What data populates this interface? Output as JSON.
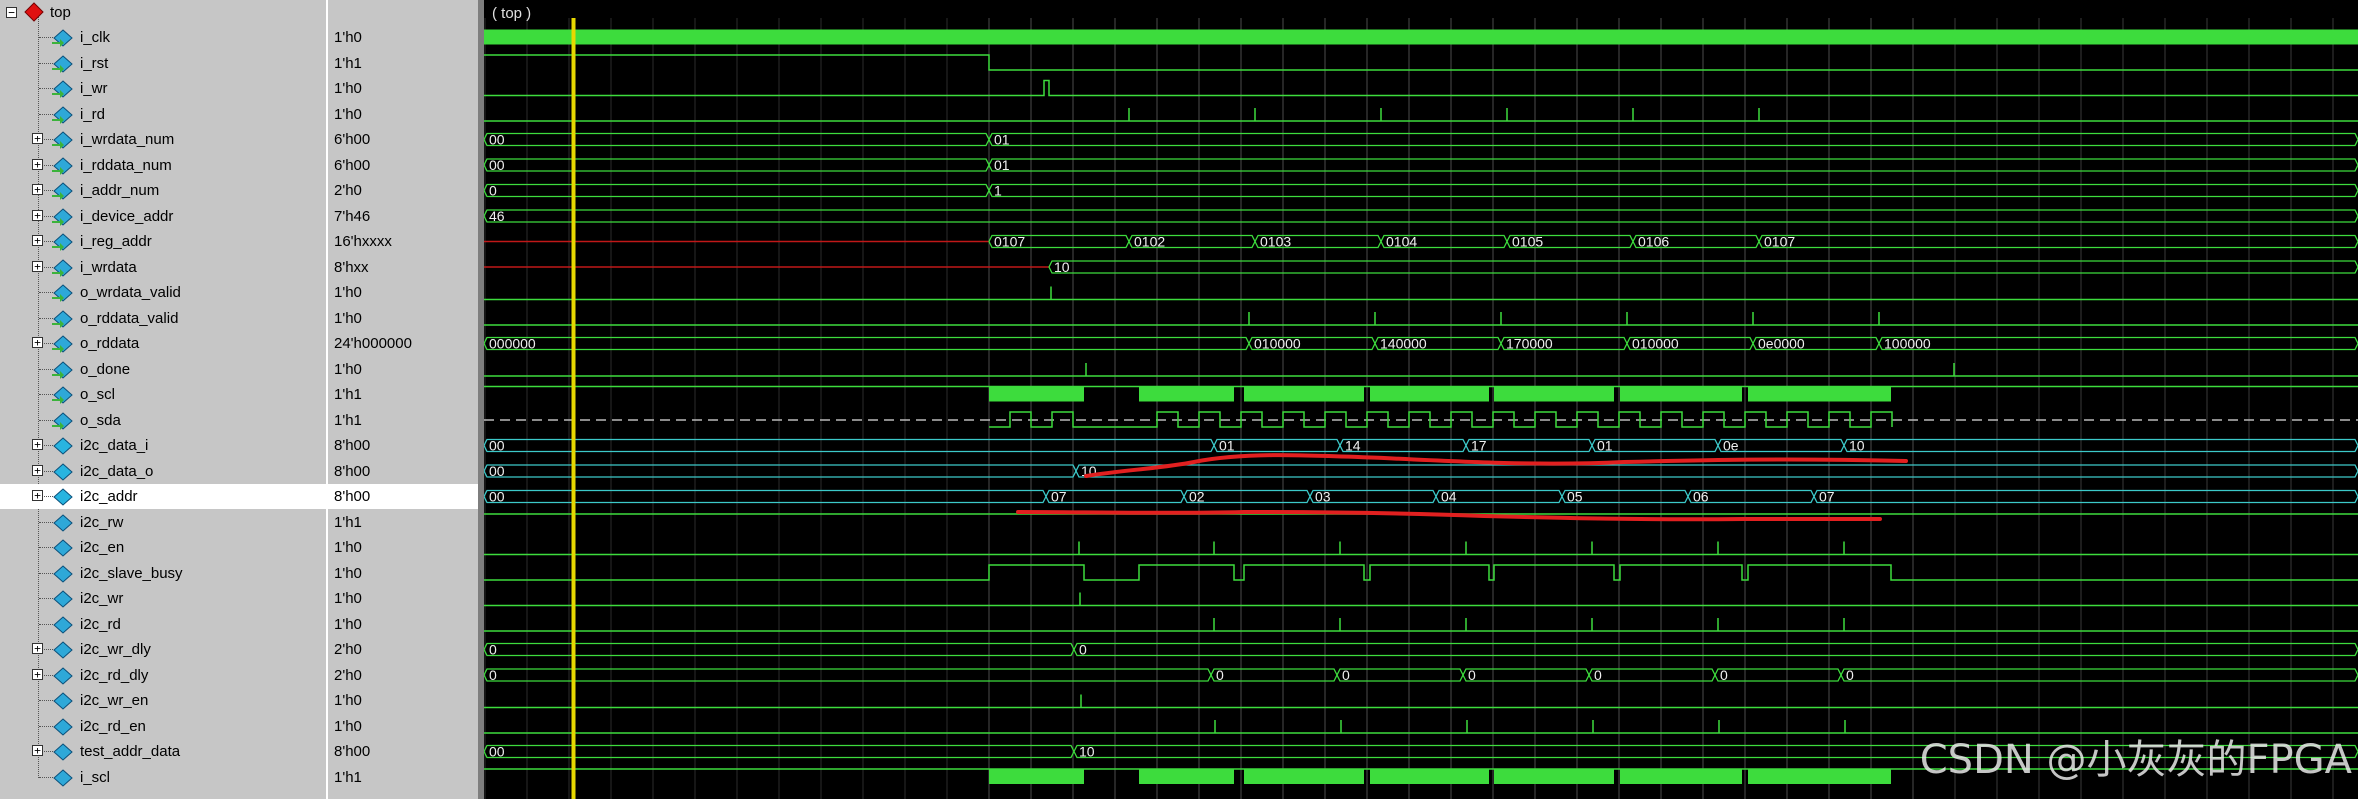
{
  "root": {
    "name": "top",
    "scope_label": "( top )"
  },
  "colors": {
    "wave": "#3ddc3d",
    "bus_cyan": "#3cc9c9",
    "undefined_red": "#c01818",
    "cursor": "#e7d800",
    "annotation": "#e22020",
    "sda_z": "#bbbbbb"
  },
  "signals": [
    {
      "name": "i_clk",
      "value": "1'h0",
      "expandable": false,
      "dir": "in",
      "color": "green"
    },
    {
      "name": "i_rst",
      "value": "1'h1",
      "expandable": false,
      "dir": "in",
      "color": "green"
    },
    {
      "name": "i_wr",
      "value": "1'h0",
      "expandable": false,
      "dir": "in",
      "color": "green"
    },
    {
      "name": "i_rd",
      "value": "1'h0",
      "expandable": false,
      "dir": "in",
      "color": "green"
    },
    {
      "name": "i_wrdata_num",
      "value": "6'h00",
      "expandable": true,
      "dir": "in",
      "color": "green"
    },
    {
      "name": "i_rddata_num",
      "value": "6'h00",
      "expandable": true,
      "dir": "in",
      "color": "green"
    },
    {
      "name": "i_addr_num",
      "value": "2'h0",
      "expandable": true,
      "dir": "in",
      "color": "green"
    },
    {
      "name": "i_device_addr",
      "value": "7'h46",
      "expandable": true,
      "dir": "in",
      "color": "green"
    },
    {
      "name": "i_reg_addr",
      "value": "16'hxxxx",
      "expandable": true,
      "dir": "in",
      "color": "green"
    },
    {
      "name": "i_wrdata",
      "value": "8'hxx",
      "expandable": true,
      "dir": "in",
      "color": "green"
    },
    {
      "name": "o_wrdata_valid",
      "value": "1'h0",
      "expandable": false,
      "dir": "out",
      "color": "green"
    },
    {
      "name": "o_rddata_valid",
      "value": "1'h0",
      "expandable": false,
      "dir": "out",
      "color": "green"
    },
    {
      "name": "o_rddata",
      "value": "24'h000000",
      "expandable": true,
      "dir": "out",
      "color": "green"
    },
    {
      "name": "o_done",
      "value": "1'h0",
      "expandable": false,
      "dir": "out",
      "color": "green"
    },
    {
      "name": "o_scl",
      "value": "1'h1",
      "expandable": false,
      "dir": "out",
      "color": "green"
    },
    {
      "name": "o_sda",
      "value": "1'h1",
      "expandable": false,
      "dir": "out",
      "color": "green"
    },
    {
      "name": "i2c_data_i",
      "value": "8'h00",
      "expandable": true,
      "dir": "int",
      "color": "cyan"
    },
    {
      "name": "i2c_data_o",
      "value": "8'h00",
      "expandable": true,
      "dir": "int",
      "color": "cyan"
    },
    {
      "name": "i2c_addr",
      "value": "8'h00",
      "expandable": true,
      "dir": "int",
      "color": "cyan",
      "selected": true
    },
    {
      "name": "i2c_rw",
      "value": "1'h1",
      "expandable": false,
      "dir": "int",
      "color": "green"
    },
    {
      "name": "i2c_en",
      "value": "1'h0",
      "expandable": false,
      "dir": "int",
      "color": "green"
    },
    {
      "name": "i2c_slave_busy",
      "value": "1'h0",
      "expandable": false,
      "dir": "int",
      "color": "green"
    },
    {
      "name": "i2c_wr",
      "value": "1'h0",
      "expandable": false,
      "dir": "int",
      "color": "green"
    },
    {
      "name": "i2c_rd",
      "value": "1'h0",
      "expandable": false,
      "dir": "int",
      "color": "green"
    },
    {
      "name": "i2c_wr_dly",
      "value": "2'h0",
      "expandable": true,
      "dir": "int",
      "color": "green"
    },
    {
      "name": "i2c_rd_dly",
      "value": "2'h0",
      "expandable": true,
      "dir": "int",
      "color": "green"
    },
    {
      "name": "i2c_wr_en",
      "value": "1'h0",
      "expandable": false,
      "dir": "int",
      "color": "green"
    },
    {
      "name": "i2c_rd_en",
      "value": "1'h0",
      "expandable": false,
      "dir": "int",
      "color": "green"
    },
    {
      "name": "test_addr_data",
      "value": "8'h00",
      "expandable": true,
      "dir": "int",
      "color": "green"
    },
    {
      "name": "i_scl",
      "value": "1'h1",
      "expandable": false,
      "dir": "int",
      "color": "green"
    }
  ],
  "bus_values": {
    "i_wrdata_num": [
      {
        "t": 0,
        "label": "00"
      },
      {
        "t": 505,
        "label": "01"
      }
    ],
    "i_rddata_num": [
      {
        "t": 0,
        "label": "00"
      },
      {
        "t": 505,
        "label": "01"
      }
    ],
    "i_addr_num": [
      {
        "t": 0,
        "label": "0"
      },
      {
        "t": 505,
        "label": "1"
      }
    ],
    "i_device_addr": [
      {
        "t": 0,
        "label": "46"
      }
    ],
    "i_reg_addr": [
      {
        "t": 505,
        "label": "0107"
      },
      {
        "t": 645,
        "label": "0102"
      },
      {
        "t": 771,
        "label": "0103"
      },
      {
        "t": 897,
        "label": "0104"
      },
      {
        "t": 1023,
        "label": "0105"
      },
      {
        "t": 1149,
        "label": "0106"
      },
      {
        "t": 1275,
        "label": "0107"
      }
    ],
    "i_wrdata": [
      {
        "t": 565,
        "label": "10"
      }
    ],
    "o_rddata": [
      {
        "t": 0,
        "label": "000000"
      },
      {
        "t": 765,
        "label": "010000"
      },
      {
        "t": 891,
        "label": "140000"
      },
      {
        "t": 1017,
        "label": "170000"
      },
      {
        "t": 1143,
        "label": "010000"
      },
      {
        "t": 1269,
        "label": "0e0000"
      },
      {
        "t": 1395,
        "label": "100000"
      }
    ],
    "i2c_data_i": [
      {
        "t": 0,
        "label": "00"
      },
      {
        "t": 730,
        "label": "01"
      },
      {
        "t": 856,
        "label": "14"
      },
      {
        "t": 982,
        "label": "17"
      },
      {
        "t": 1108,
        "label": "01"
      },
      {
        "t": 1234,
        "label": "0e"
      },
      {
        "t": 1360,
        "label": "10"
      }
    ],
    "i2c_data_o": [
      {
        "t": 0,
        "label": "00"
      },
      {
        "t": 592,
        "label": "10"
      }
    ],
    "i2c_addr": [
      {
        "t": 0,
        "label": "00"
      },
      {
        "t": 562,
        "label": "07"
      },
      {
        "t": 700,
        "label": "02"
      },
      {
        "t": 826,
        "label": "03"
      },
      {
        "t": 952,
        "label": "04"
      },
      {
        "t": 1078,
        "label": "05"
      },
      {
        "t": 1204,
        "label": "06"
      },
      {
        "t": 1330,
        "label": "07"
      }
    ],
    "i2c_wr_dly": [
      {
        "t": 0,
        "label": "0"
      },
      {
        "t": 590,
        "label": "0"
      }
    ],
    "i2c_rd_dly": [
      {
        "t": 0,
        "label": "0"
      },
      {
        "t": 727,
        "label": "0"
      },
      {
        "t": 853,
        "label": "0"
      },
      {
        "t": 979,
        "label": "0"
      },
      {
        "t": 1105,
        "label": "0"
      },
      {
        "t": 1231,
        "label": "0"
      },
      {
        "t": 1357,
        "label": "0"
      }
    ],
    "test_addr_data": [
      {
        "t": 0,
        "label": "00"
      },
      {
        "t": 590,
        "label": "10"
      }
    ]
  },
  "watermark": "CSDN @小灰灰的FPGA"
}
